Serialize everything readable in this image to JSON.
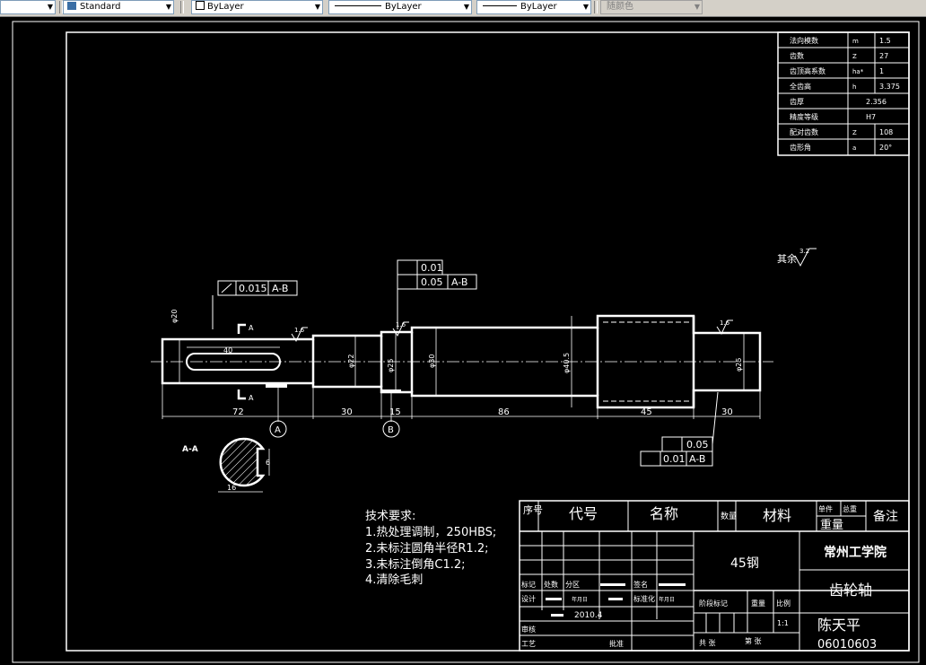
{
  "toolbar": {
    "first_combo": "",
    "text_style": "Standard",
    "layer_color": "ByLayer",
    "linetype": "ByLayer",
    "lineweight": "ByLayer",
    "plot_style": "随颜色"
  },
  "gear_table": {
    "rows": [
      {
        "label": "法向模数",
        "symbol": "m",
        "value": "1.5"
      },
      {
        "label": "齿数",
        "symbol": "Z",
        "value": "27"
      },
      {
        "label": "齿顶高系数",
        "symbol": "ha*",
        "value": "1"
      },
      {
        "label": "全齿高",
        "symbol": "h",
        "value": "3.375"
      },
      {
        "label": "齿厚",
        "symbol": "",
        "value": "2.356"
      },
      {
        "label": "精度等级",
        "symbol": "",
        "value": "H7"
      },
      {
        "label": "配对齿数",
        "symbol": "Z",
        "value": "108"
      },
      {
        "label": "齿形角",
        "symbol": "a",
        "value": "20°"
      }
    ]
  },
  "drawing": {
    "roughness_note": "其余",
    "roughness_value": "3.2",
    "tol_left": {
      "value": "0.015",
      "datum": "A-B"
    },
    "tol_mid": [
      {
        "value": "0.01",
        "datum": ""
      },
      {
        "value": "0.05",
        "datum": "A-B"
      }
    ],
    "tol_right": [
      {
        "value": "0.05",
        "datum": ""
      },
      {
        "value": "0.01",
        "datum": "A-B"
      }
    ],
    "dims": {
      "len_72": "72",
      "len_30a": "30",
      "len_15": "15",
      "len_86": "86",
      "len_45": "45",
      "len_30b": "30",
      "d_20": "φ20",
      "d_22": "φ22",
      "d_25": "φ25",
      "d_30": "φ30",
      "d_405": "φ40.5",
      "d_25b": "φ25",
      "key_40": "40",
      "key_16": "16",
      "key_6": "6"
    },
    "datum_a": "A",
    "datum_b": "B",
    "section_label": "A-A",
    "roughness_16": "1.6"
  },
  "tech_notes": {
    "title": "技术要求:",
    "items": [
      "1.热处理调制，250HBS;",
      "2.未标注圆角半径R1.2;",
      "3.未标注倒角C1.2;",
      "4.清除毛刺"
    ]
  },
  "title_block": {
    "h_seq": "序号",
    "h_code": "代号",
    "h_name": "名称",
    "h_qty": "数量",
    "h_material": "材料",
    "h_single": "单件",
    "h_total": "总重",
    "h_weight": "重量",
    "h_remark": "备注",
    "material": "45钢",
    "school": "常州工学院",
    "part_name": "齿轮轴",
    "designer": "陈天平",
    "drawing_no": "06010603",
    "mark": "标记",
    "zone_count": "处数",
    "zone": "分区",
    "sign": "签名",
    "design": "设计",
    "date_mark": "年月日",
    "std": "标准化",
    "date": "2010.4",
    "review": "审核",
    "process": "工艺",
    "approve": "批准",
    "stage": "阶段标记",
    "weight": "重量",
    "scale": "比例",
    "scale_val": "1:1",
    "sheets_total": "共  张",
    "sheet_no": "第  张"
  }
}
